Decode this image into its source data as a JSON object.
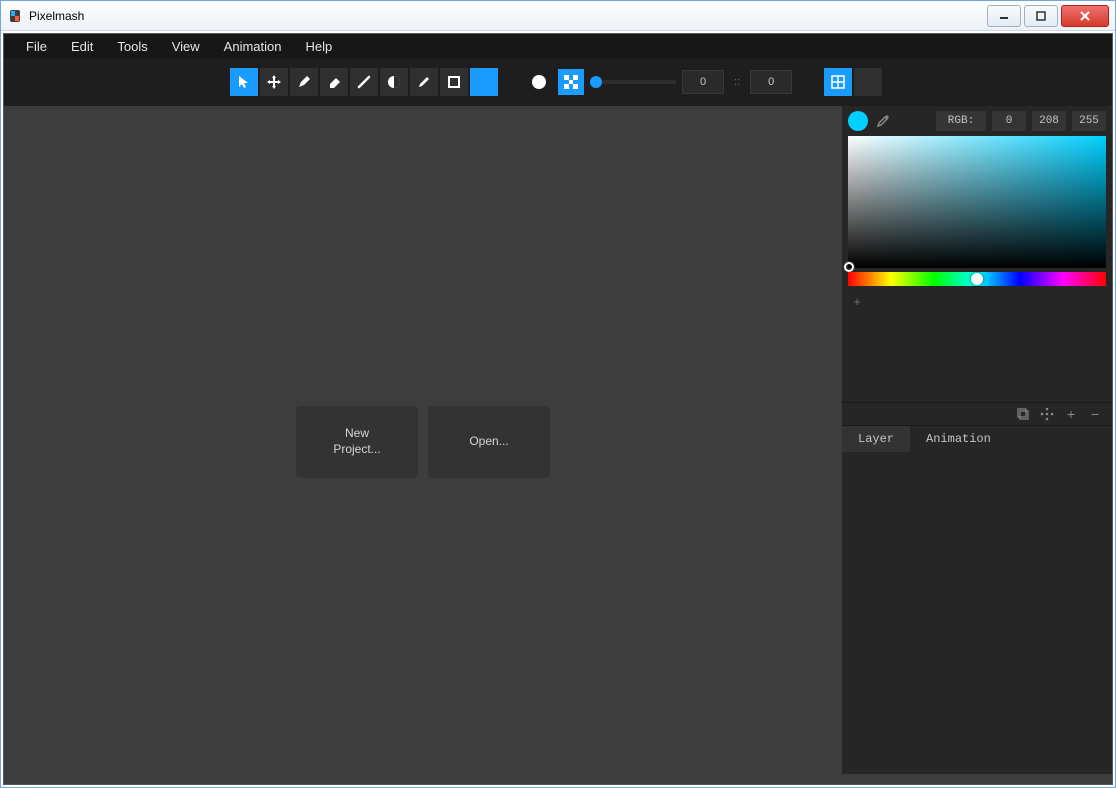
{
  "window": {
    "title": "Pixelmash"
  },
  "menu": {
    "file": "File",
    "edit": "Edit",
    "tools": "Tools",
    "view": "View",
    "animation": "Animation",
    "help": "Help"
  },
  "toolbar": {
    "size1": "0",
    "sizesep": "::",
    "size2": "0"
  },
  "start": {
    "new": "New\nProject...",
    "open": "Open..."
  },
  "color": {
    "mode": "RGB:",
    "r": "0",
    "g": "208",
    "b": "255"
  },
  "tabs": {
    "layer": "Layer",
    "animation": "Animation"
  }
}
